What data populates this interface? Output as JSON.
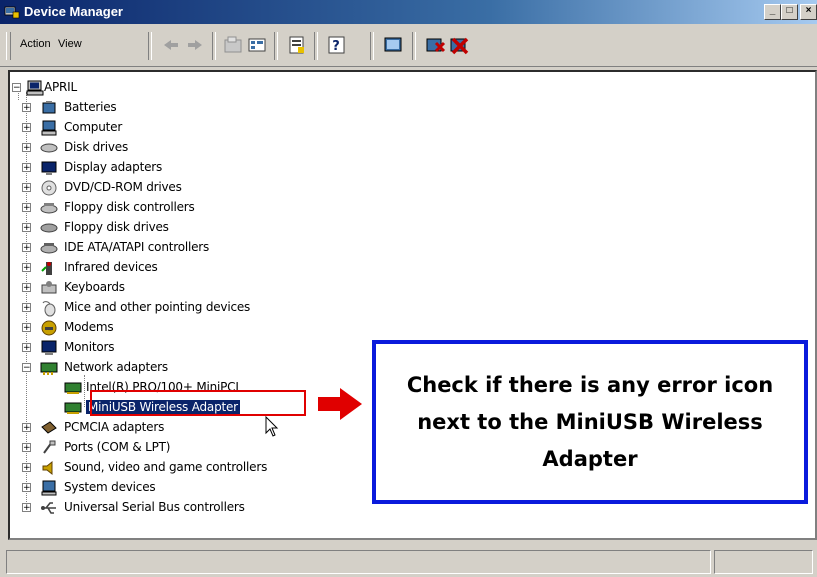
{
  "window": {
    "title": "Device Manager",
    "controls": [
      "minimize",
      "maximize",
      "close"
    ]
  },
  "menu": {
    "action": "Action",
    "view": "View"
  },
  "toolbar_icons": [
    "back-icon",
    "forward-icon",
    "up-icon",
    "view-icon",
    "properties-icon",
    "help-icon",
    "scan-icon",
    "update-driver-icon",
    "uninstall-icon"
  ],
  "tree": {
    "root": "APRIL",
    "items": [
      {
        "label": "Batteries",
        "icon": "battery-icon"
      },
      {
        "label": "Computer",
        "icon": "computer-icon"
      },
      {
        "label": "Disk drives",
        "icon": "disk-drive-icon"
      },
      {
        "label": "Display adapters",
        "icon": "display-icon"
      },
      {
        "label": "DVD/CD-ROM drives",
        "icon": "dvd-icon"
      },
      {
        "label": "Floppy disk controllers",
        "icon": "floppy-controller-icon"
      },
      {
        "label": "Floppy disk drives",
        "icon": "floppy-drive-icon"
      },
      {
        "label": "IDE ATA/ATAPI controllers",
        "icon": "ide-icon"
      },
      {
        "label": "Infrared devices",
        "icon": "infrared-icon"
      },
      {
        "label": "Keyboards",
        "icon": "keyboard-icon"
      },
      {
        "label": "Mice and other pointing devices",
        "icon": "mouse-icon"
      },
      {
        "label": "Modems",
        "icon": "modem-icon"
      },
      {
        "label": "Monitors",
        "icon": "monitor-icon"
      },
      {
        "label": "Network adapters",
        "icon": "network-icon",
        "expanded": true,
        "children": [
          {
            "label": "Intel(R) PRO/100+ MiniPCI",
            "icon": "nic-icon"
          },
          {
            "label": "MiniUSB Wireless Adapter",
            "icon": "nic-icon",
            "selected": true
          }
        ]
      },
      {
        "label": "PCMCIA adapters",
        "icon": "pcmcia-icon"
      },
      {
        "label": "Ports (COM & LPT)",
        "icon": "port-icon"
      },
      {
        "label": "Sound, video and game controllers",
        "icon": "sound-icon"
      },
      {
        "label": "System devices",
        "icon": "system-icon"
      },
      {
        "label": "Universal Serial Bus controllers",
        "icon": "usb-icon"
      }
    ]
  },
  "callout": {
    "text": "Check if there is any error icon next to the MiniUSB Wireless Adapter",
    "border_color": "#0a1adc"
  },
  "colors": {
    "highlight": "#e00000",
    "arrow": "#e00000",
    "selection": "#0a246a"
  }
}
